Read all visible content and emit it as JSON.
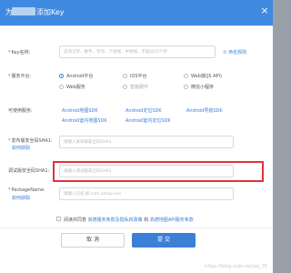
{
  "colors": {
    "accent": "#3b7fd6",
    "titlebar": "#3f8ae0",
    "required": "#e2333a",
    "highlight": "#e2333a"
  },
  "dialog": {
    "title_prefix": "为",
    "title_main": "添加Key",
    "close_icon": "close-icon"
  },
  "form": {
    "key_name": {
      "label": "Key名称:",
      "placeholder": "支持汉字、数字、字母、下划线、中划线、不超过15个字",
      "help_link": "① 命名规则"
    },
    "platform": {
      "label": "服务平台:",
      "options": [
        {
          "label": "Android平台",
          "selected": true,
          "muted": false
        },
        {
          "label": "iOS平台",
          "selected": false,
          "muted": false
        },
        {
          "label": "Web端(JS API)",
          "selected": false,
          "muted": false
        },
        {
          "label": "Web服务",
          "selected": false,
          "muted": false
        },
        {
          "label": "智能硬件",
          "selected": false,
          "muted": true
        },
        {
          "label": "微信小程序",
          "selected": false,
          "muted": false
        }
      ]
    },
    "sdk": {
      "label": "可使用服务:",
      "items": [
        "Android地图SDK",
        "Android定位SDK",
        "Android导航SDK",
        "Android室内地图SDK",
        "Android室内定位SDK"
      ]
    },
    "release_sha1": {
      "label": "发布版安全码SHA1:",
      "link": "如何获取",
      "placeholder": "请输入发布版安全码SHA1"
    },
    "debug_sha1": {
      "label": "调试版安全码SHA1:",
      "placeholder": "请输入调试版安全码SHA1"
    },
    "package_name": {
      "label": "PackageName:",
      "link": "如何获取",
      "placeholder": "请输入包名,如:com.amap.xxx"
    },
    "agreement": {
      "prefix": "阅读并同意",
      "link1": "高德服务条款及隐私权政策",
      "middle": "和",
      "link2": "高德地图API服务条款"
    }
  },
  "buttons": {
    "cancel": "取 消",
    "submit": "提 交"
  },
  "watermark": "https://blog.csdn.net/qq_35"
}
